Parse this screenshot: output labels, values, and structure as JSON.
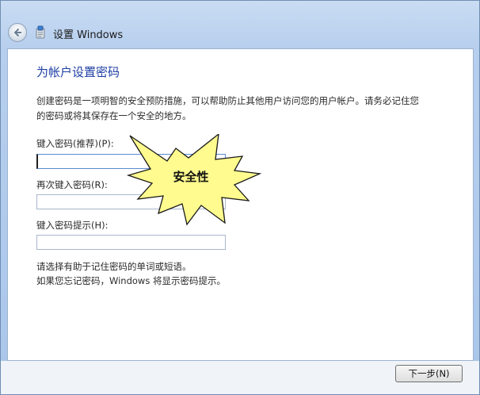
{
  "window": {
    "title": "设置 Windows"
  },
  "page": {
    "heading": "为帐户设置密码",
    "description_line1": "创建密码是一项明智的安全预防措施，可以帮助防止其他用户访问您的用户帐户。请务必记住您",
    "description_line2": "的密码或将其保存在一个安全的地方。",
    "password_label": "键入密码(推荐)(P):",
    "password_value": "",
    "confirm_label": "再次键入密码(R):",
    "confirm_value": "",
    "hint_label": "键入密码提示(H):",
    "hint_value": "",
    "helper_line1": "请选择有助于记住密码的单词或短语。",
    "helper_line2": "如果您忘记密码，Windows 将显示密码提示。"
  },
  "callout": {
    "text": "安全性",
    "fill_color": "#fffb8e",
    "stroke_color": "#1a1a1a"
  },
  "footer": {
    "next_label": "下一步(N)"
  },
  "icons": {
    "back": "back-arrow-icon",
    "app": "setup-icon"
  },
  "colors": {
    "heading": "#1d3fa3",
    "titlebar": "#b7cfee"
  }
}
